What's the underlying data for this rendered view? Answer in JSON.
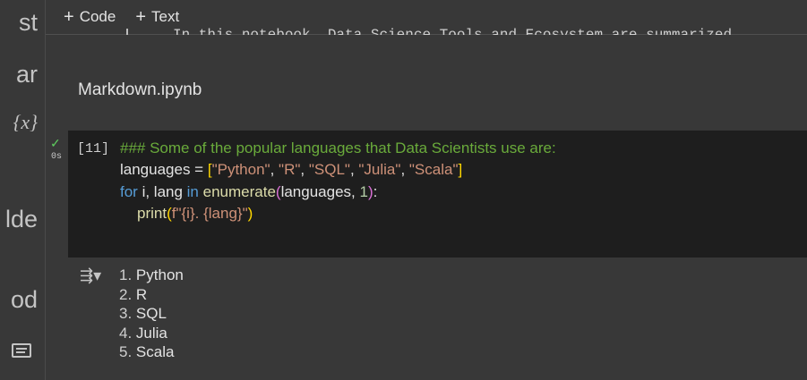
{
  "toolbar": {
    "code_label": "Code",
    "text_label": "Text"
  },
  "sidebar": {
    "fragments": [
      "st",
      "ar",
      "{x}",
      "lde",
      "od"
    ]
  },
  "cut_text": "In this notebook, Data Science Tools and Ecosystem are summarized.",
  "markdown_title": "Markdown.ipynb",
  "cell": {
    "exec_count": "[11]",
    "run_time": "0s",
    "comment": "### Some of the popular languages that Data Scientists use are:",
    "languages_literal": [
      "\"Python\"",
      "\"R\"",
      "\"SQL\"",
      "\"Julia\"",
      "\"Scala\""
    ],
    "line3_parts": {
      "for": "for",
      "vars": " i, lang ",
      "in": "in",
      "enum": "enumerate",
      "args": "languages, ",
      "one": "1",
      "colon": ":"
    },
    "line4_parts": {
      "print": "print",
      "fstr": "f\"{i}. {lang}\""
    }
  },
  "output": {
    "items": [
      {
        "num": "1.",
        "text": "Python"
      },
      {
        "num": "2.",
        "text": "R"
      },
      {
        "num": "3.",
        "text": "SQL"
      },
      {
        "num": "4.",
        "text": "Julia"
      },
      {
        "num": "5.",
        "text": "Scala"
      }
    ]
  },
  "colors": {
    "background": "#383838",
    "cell_bg": "#1e1e1e",
    "comment": "#6aab3b",
    "string": "#ce9178",
    "keyword": "#569cd6",
    "success": "#5fce5f"
  }
}
